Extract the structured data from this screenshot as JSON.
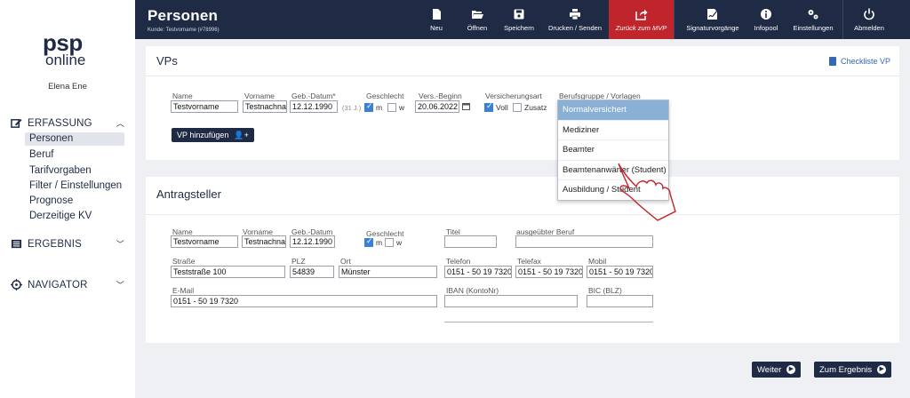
{
  "header": {
    "title": "Personen",
    "subtitle": "Kunde: Testvorname (#78996)",
    "nav": [
      {
        "label": "Neu",
        "icon": "file-icon"
      },
      {
        "label": "Öffnen",
        "icon": "folder-open-icon"
      },
      {
        "label": "Speichern",
        "icon": "save-icon"
      },
      {
        "label": "Drucken / Senden",
        "icon": "print-icon"
      },
      {
        "label": "Zurück zum MVP",
        "icon": "share-icon",
        "active": true
      },
      {
        "label": "Signaturvorgänge",
        "icon": "signature-icon"
      },
      {
        "label": "Infopool",
        "icon": "info-icon"
      },
      {
        "label": "Einstellungen",
        "icon": "gears-icon"
      },
      {
        "label": "Abmelden",
        "icon": "power-icon"
      }
    ]
  },
  "sidebar": {
    "logo_top": "psp",
    "logo_bottom": "online",
    "user": "Elena Ene",
    "sections": [
      {
        "label": "ERFASSUNG",
        "icon": "edit-icon",
        "expanded": true,
        "items": [
          "Personen",
          "Beruf",
          "Tarifvorgaben",
          "Filter / Einstellungen",
          "Prognose",
          "Derzeitige KV"
        ]
      },
      {
        "label": "ERGEBNIS",
        "icon": "list-icon",
        "expanded": false
      },
      {
        "label": "NAVIGATOR",
        "icon": "crosshair-icon",
        "expanded": false
      }
    ]
  },
  "vps": {
    "title": "VPs",
    "checklist": "Checkliste VP",
    "labels": {
      "name": "Name",
      "vorname": "Vorname",
      "geb": "Geb.-Datum*",
      "geschlecht": "Geschlecht",
      "vers_beginn": "Vers.-Beginn",
      "versicherungsart": "Versicherungsart",
      "berufsgruppe": "Berufsgruppe / Vorlagen"
    },
    "values": {
      "name": "Testvorname",
      "vorname": "Testnachna",
      "geb": "12.12.1990",
      "age": "(31 J.)",
      "vers_beginn": "20.06.2022"
    },
    "gender": {
      "m": "m",
      "w": "w"
    },
    "versart": {
      "voll": "Voll",
      "zusatz": "Zusatz"
    },
    "add_button": "VP hinzufügen",
    "dropdown": [
      "Normalversichert",
      "Mediziner",
      "Beamter",
      "Beamtenanwärter (Student)",
      "Ausbildung / Student"
    ]
  },
  "antrag": {
    "title": "Antragsteller",
    "labels": {
      "name": "Name",
      "vorname": "Vorname",
      "geb": "Geb.-Datum",
      "geschlecht": "Geschlecht",
      "titel": "Titel",
      "beruf": "ausgeübter Beruf",
      "strasse": "Straße",
      "plz": "PLZ",
      "ort": "Ort",
      "telefon": "Telefon",
      "telefax": "Telefax",
      "mobil": "Mobil",
      "email": "E-Mail",
      "iban": "IBAN (KontoNr)",
      "bic": "BIC (BLZ)"
    },
    "values": {
      "name": "Testvorname",
      "vorname": "Testnachna",
      "geb": "12.12.1990",
      "strasse": "Teststraße 100",
      "plz": "54839",
      "ort": "Münster",
      "telefon": "0151 - 50 19 7320",
      "telefax": "0151 - 50 19 7320",
      "mobil": "0151 - 50 19 7320",
      "email": "0151 - 50 19 7320",
      "titel": "",
      "beruf": "",
      "iban": "",
      "bic": ""
    },
    "gender": {
      "m": "m",
      "w": "w"
    }
  },
  "footer": {
    "weiter": "Weiter",
    "ergebnis": "Zum Ergebnis"
  }
}
